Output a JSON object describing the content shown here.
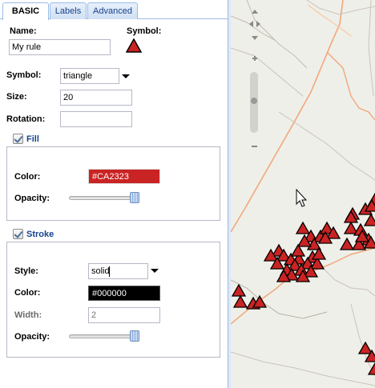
{
  "tabs": [
    {
      "label": "BASIC",
      "active": true
    },
    {
      "label": "Labels",
      "active": false
    },
    {
      "label": "Advanced",
      "active": false
    }
  ],
  "rule": {
    "name_label": "Name:",
    "name_value": "My rule",
    "symbol_preview_label": "Symbol:"
  },
  "symbol": {
    "symbol_label": "Symbol:",
    "symbol_value": "triangle",
    "size_label": "Size:",
    "size_value": "20",
    "rotation_label": "Rotation:",
    "rotation_value": ""
  },
  "fill": {
    "legend": "Fill",
    "color_label": "Color:",
    "color_value": "#CA2323",
    "opacity_label": "Opacity:",
    "opacity_level": 1.0
  },
  "stroke": {
    "legend": "Stroke",
    "style_label": "Style:",
    "style_value": "solid",
    "color_label": "Color:",
    "color_value": "#000000",
    "width_label": "Width:",
    "width_value": "2",
    "opacity_label": "Opacity:",
    "opacity_level": 1.0
  },
  "colors": {
    "fill": "#CA2323",
    "stroke": "#000000",
    "tab_border": "#99bbe8",
    "legend_text": "#15428b",
    "map_bg": "#efefe9",
    "road_orange": "#f2a77a",
    "road_gray": "#b9b1a3"
  },
  "map": {
    "controls": [
      "pan-up-icon",
      "pan-left-icon",
      "pan-right-icon",
      "pan-down-icon",
      "zoom-in-icon",
      "zoom-slider",
      "zoom-out-icon"
    ],
    "feature_symbol": "triangle",
    "feature_count": 46
  }
}
